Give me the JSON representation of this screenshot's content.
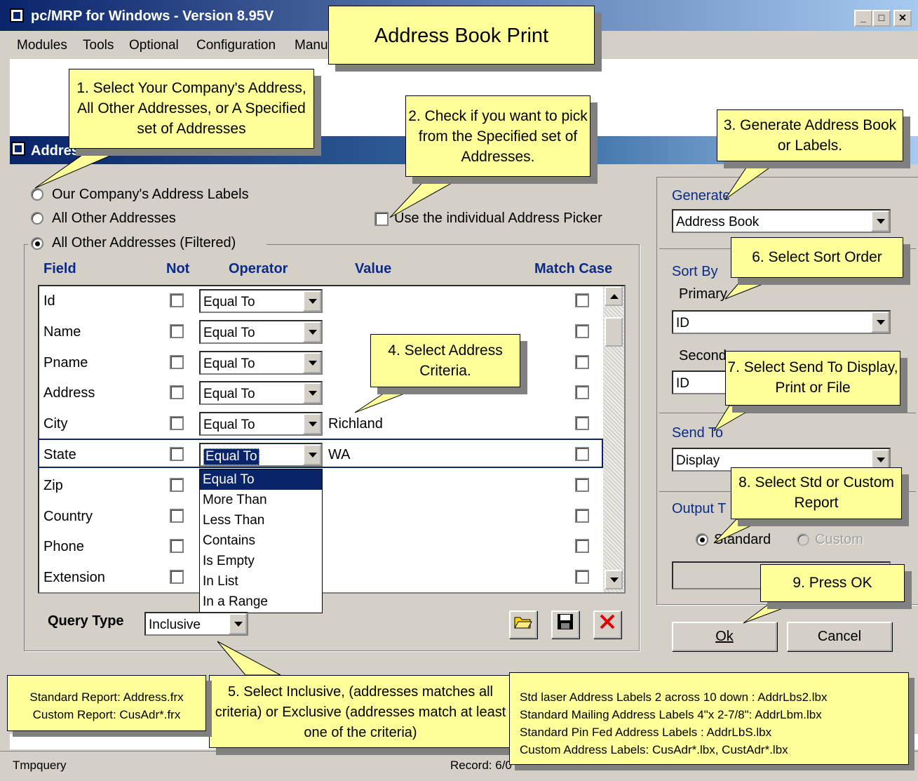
{
  "app": {
    "title": "pc/MRP for Windows - Version 8.95V",
    "menu": [
      "Modules",
      "Tools",
      "Optional",
      "Configuration",
      "Manu"
    ]
  },
  "dialog": {
    "title": "Addres",
    "scope_options": [
      {
        "label": "Our Company's Address Labels",
        "selected": false
      },
      {
        "label": "All Other Addresses",
        "selected": false
      },
      {
        "label": "All Other Addresses (Filtered)",
        "selected": true
      }
    ],
    "picker_label": "Use the individual Address Picker",
    "grid_headers": {
      "field": "Field",
      "not": "Not",
      "operator": "Operator",
      "value": "Value",
      "match_case": "Match Case"
    },
    "rows": [
      {
        "field": "Id",
        "operator": "Equal To",
        "value": ""
      },
      {
        "field": "Name",
        "operator": "Equal To",
        "value": ""
      },
      {
        "field": "Pname",
        "operator": "Equal To",
        "value": ""
      },
      {
        "field": "Address",
        "operator": "Equal To",
        "value": ""
      },
      {
        "field": "City",
        "operator": "Equal To",
        "value": "Richland"
      },
      {
        "field": "State",
        "operator": "Equal To",
        "value": "WA"
      },
      {
        "field": "Zip",
        "operator": "",
        "value": ""
      },
      {
        "field": "Country",
        "operator": "",
        "value": ""
      },
      {
        "field": "Phone",
        "operator": "",
        "value": ""
      },
      {
        "field": "Extension",
        "operator": "",
        "value": ""
      }
    ],
    "operator_options": [
      "Equal To",
      "More Than",
      "Less Than",
      "Contains",
      "Is Empty",
      "In List",
      "In a Range"
    ],
    "query_type_label": "Query Type",
    "query_type_value": "Inclusive",
    "generate_label": "Generate",
    "generate_value": "Address Book",
    "sort_by_label": "Sort By",
    "primary_label": "Primary",
    "primary_value": "ID",
    "secondary_label": "Second",
    "secondary_value": "ID",
    "send_to_label": "Send To",
    "send_to_value": "Display",
    "output_type_label": "Output T",
    "output_standard": "Standard",
    "output_custom": "Custom",
    "ok_label": "Ok",
    "cancel_label": "Cancel"
  },
  "status": {
    "left": "Tmpquery",
    "right": "Record: 6/0"
  },
  "callouts": {
    "title": "Address Book Print",
    "c1": "1. Select Your Company's Address, All Other Addresses, or A Specified set of Addresses",
    "c2": "2. Check if you want to pick from the Specified set of Addresses.",
    "c3": "3. Generate Address Book or Labels.",
    "c4": "4. Select Address Criteria.",
    "c5": "5. Select Inclusive, (addresses matches all criteria) or Exclusive (addresses match at least one of the criteria)",
    "c6": "6. Select Sort Order",
    "c7": "7. Select Send To Display, Print or File",
    "c8": "8. Select Std or Custom Report",
    "c9": "9. Press OK",
    "note_left": [
      "Standard Report: Address.frx",
      "Custom Report: CusAdr*.frx"
    ],
    "note_right": [
      "Std laser Address Labels 2 across 10 down : AddrLbs2.lbx",
      "Standard Mailing Address Labels 4\"x 2-7/8\": AddrLbm.lbx",
      "Standard Pin Fed Address Labels : AddrLbS.lbx",
      "Custom Address Labels: CusAdr*.lbx, CustAdr*.lbx"
    ]
  },
  "colors": {
    "title_bar": "#0a246a",
    "callout": "#ffff99",
    "header_text": "#0a2a8c",
    "delete_icon": "#e00000"
  }
}
